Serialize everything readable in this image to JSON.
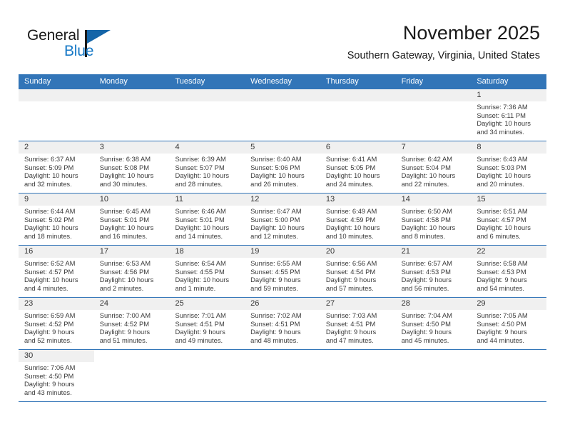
{
  "brand": {
    "name_part1": "General",
    "name_part2": "Blue"
  },
  "header": {
    "title": "November 2025",
    "subtitle": "Southern Gateway, Virginia, United States"
  },
  "colors": {
    "header_blue": "#3275b8",
    "logo_blue": "#1678c6",
    "day_strip_gray": "#f0f0f0"
  },
  "weekdays": [
    "Sunday",
    "Monday",
    "Tuesday",
    "Wednesday",
    "Thursday",
    "Friday",
    "Saturday"
  ],
  "weeks": [
    [
      {
        "empty": true
      },
      {
        "empty": true
      },
      {
        "empty": true
      },
      {
        "empty": true
      },
      {
        "empty": true
      },
      {
        "empty": true
      },
      {
        "day": "1",
        "sunrise": "Sunrise: 7:36 AM",
        "sunset": "Sunset: 6:11 PM",
        "daylight_1": "Daylight: 10 hours",
        "daylight_2": "and 34 minutes."
      }
    ],
    [
      {
        "day": "2",
        "sunrise": "Sunrise: 6:37 AM",
        "sunset": "Sunset: 5:09 PM",
        "daylight_1": "Daylight: 10 hours",
        "daylight_2": "and 32 minutes."
      },
      {
        "day": "3",
        "sunrise": "Sunrise: 6:38 AM",
        "sunset": "Sunset: 5:08 PM",
        "daylight_1": "Daylight: 10 hours",
        "daylight_2": "and 30 minutes."
      },
      {
        "day": "4",
        "sunrise": "Sunrise: 6:39 AM",
        "sunset": "Sunset: 5:07 PM",
        "daylight_1": "Daylight: 10 hours",
        "daylight_2": "and 28 minutes."
      },
      {
        "day": "5",
        "sunrise": "Sunrise: 6:40 AM",
        "sunset": "Sunset: 5:06 PM",
        "daylight_1": "Daylight: 10 hours",
        "daylight_2": "and 26 minutes."
      },
      {
        "day": "6",
        "sunrise": "Sunrise: 6:41 AM",
        "sunset": "Sunset: 5:05 PM",
        "daylight_1": "Daylight: 10 hours",
        "daylight_2": "and 24 minutes."
      },
      {
        "day": "7",
        "sunrise": "Sunrise: 6:42 AM",
        "sunset": "Sunset: 5:04 PM",
        "daylight_1": "Daylight: 10 hours",
        "daylight_2": "and 22 minutes."
      },
      {
        "day": "8",
        "sunrise": "Sunrise: 6:43 AM",
        "sunset": "Sunset: 5:03 PM",
        "daylight_1": "Daylight: 10 hours",
        "daylight_2": "and 20 minutes."
      }
    ],
    [
      {
        "day": "9",
        "sunrise": "Sunrise: 6:44 AM",
        "sunset": "Sunset: 5:02 PM",
        "daylight_1": "Daylight: 10 hours",
        "daylight_2": "and 18 minutes."
      },
      {
        "day": "10",
        "sunrise": "Sunrise: 6:45 AM",
        "sunset": "Sunset: 5:01 PM",
        "daylight_1": "Daylight: 10 hours",
        "daylight_2": "and 16 minutes."
      },
      {
        "day": "11",
        "sunrise": "Sunrise: 6:46 AM",
        "sunset": "Sunset: 5:01 PM",
        "daylight_1": "Daylight: 10 hours",
        "daylight_2": "and 14 minutes."
      },
      {
        "day": "12",
        "sunrise": "Sunrise: 6:47 AM",
        "sunset": "Sunset: 5:00 PM",
        "daylight_1": "Daylight: 10 hours",
        "daylight_2": "and 12 minutes."
      },
      {
        "day": "13",
        "sunrise": "Sunrise: 6:49 AM",
        "sunset": "Sunset: 4:59 PM",
        "daylight_1": "Daylight: 10 hours",
        "daylight_2": "and 10 minutes."
      },
      {
        "day": "14",
        "sunrise": "Sunrise: 6:50 AM",
        "sunset": "Sunset: 4:58 PM",
        "daylight_1": "Daylight: 10 hours",
        "daylight_2": "and 8 minutes."
      },
      {
        "day": "15",
        "sunrise": "Sunrise: 6:51 AM",
        "sunset": "Sunset: 4:57 PM",
        "daylight_1": "Daylight: 10 hours",
        "daylight_2": "and 6 minutes."
      }
    ],
    [
      {
        "day": "16",
        "sunrise": "Sunrise: 6:52 AM",
        "sunset": "Sunset: 4:57 PM",
        "daylight_1": "Daylight: 10 hours",
        "daylight_2": "and 4 minutes."
      },
      {
        "day": "17",
        "sunrise": "Sunrise: 6:53 AM",
        "sunset": "Sunset: 4:56 PM",
        "daylight_1": "Daylight: 10 hours",
        "daylight_2": "and 2 minutes."
      },
      {
        "day": "18",
        "sunrise": "Sunrise: 6:54 AM",
        "sunset": "Sunset: 4:55 PM",
        "daylight_1": "Daylight: 10 hours",
        "daylight_2": "and 1 minute."
      },
      {
        "day": "19",
        "sunrise": "Sunrise: 6:55 AM",
        "sunset": "Sunset: 4:55 PM",
        "daylight_1": "Daylight: 9 hours",
        "daylight_2": "and 59 minutes."
      },
      {
        "day": "20",
        "sunrise": "Sunrise: 6:56 AM",
        "sunset": "Sunset: 4:54 PM",
        "daylight_1": "Daylight: 9 hours",
        "daylight_2": "and 57 minutes."
      },
      {
        "day": "21",
        "sunrise": "Sunrise: 6:57 AM",
        "sunset": "Sunset: 4:53 PM",
        "daylight_1": "Daylight: 9 hours",
        "daylight_2": "and 56 minutes."
      },
      {
        "day": "22",
        "sunrise": "Sunrise: 6:58 AM",
        "sunset": "Sunset: 4:53 PM",
        "daylight_1": "Daylight: 9 hours",
        "daylight_2": "and 54 minutes."
      }
    ],
    [
      {
        "day": "23",
        "sunrise": "Sunrise: 6:59 AM",
        "sunset": "Sunset: 4:52 PM",
        "daylight_1": "Daylight: 9 hours",
        "daylight_2": "and 52 minutes."
      },
      {
        "day": "24",
        "sunrise": "Sunrise: 7:00 AM",
        "sunset": "Sunset: 4:52 PM",
        "daylight_1": "Daylight: 9 hours",
        "daylight_2": "and 51 minutes."
      },
      {
        "day": "25",
        "sunrise": "Sunrise: 7:01 AM",
        "sunset": "Sunset: 4:51 PM",
        "daylight_1": "Daylight: 9 hours",
        "daylight_2": "and 49 minutes."
      },
      {
        "day": "26",
        "sunrise": "Sunrise: 7:02 AM",
        "sunset": "Sunset: 4:51 PM",
        "daylight_1": "Daylight: 9 hours",
        "daylight_2": "and 48 minutes."
      },
      {
        "day": "27",
        "sunrise": "Sunrise: 7:03 AM",
        "sunset": "Sunset: 4:51 PM",
        "daylight_1": "Daylight: 9 hours",
        "daylight_2": "and 47 minutes."
      },
      {
        "day": "28",
        "sunrise": "Sunrise: 7:04 AM",
        "sunset": "Sunset: 4:50 PM",
        "daylight_1": "Daylight: 9 hours",
        "daylight_2": "and 45 minutes."
      },
      {
        "day": "29",
        "sunrise": "Sunrise: 7:05 AM",
        "sunset": "Sunset: 4:50 PM",
        "daylight_1": "Daylight: 9 hours",
        "daylight_2": "and 44 minutes."
      }
    ],
    [
      {
        "day": "30",
        "sunrise": "Sunrise: 7:06 AM",
        "sunset": "Sunset: 4:50 PM",
        "daylight_1": "Daylight: 9 hours",
        "daylight_2": "and 43 minutes."
      },
      {
        "blank": true
      },
      {
        "blank": true
      },
      {
        "blank": true
      },
      {
        "blank": true
      },
      {
        "blank": true
      },
      {
        "blank": true
      }
    ]
  ]
}
